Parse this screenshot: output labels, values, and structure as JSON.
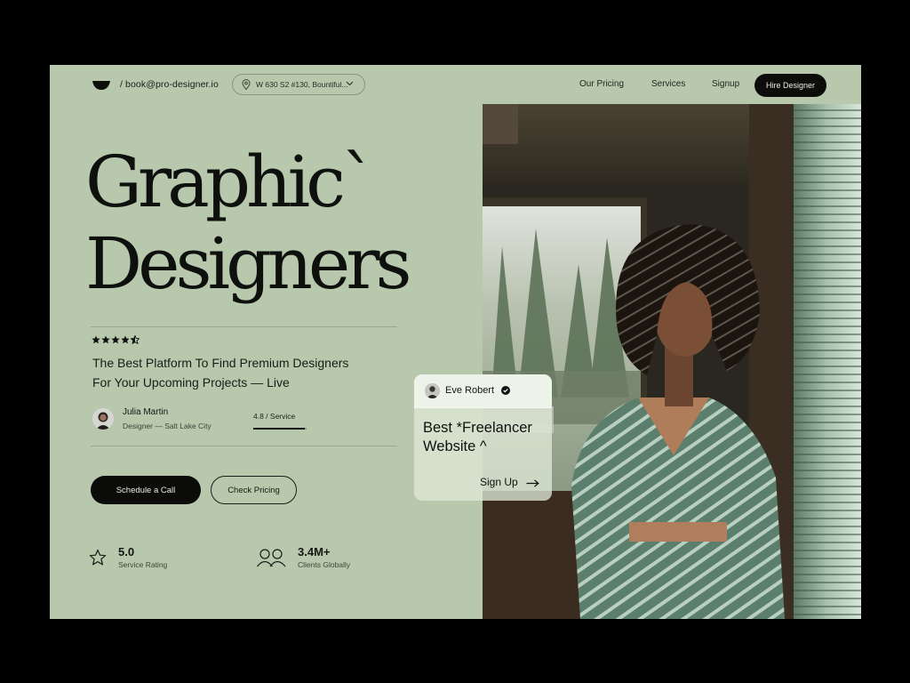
{
  "header": {
    "email": "/ book@pro-designer.io",
    "address": "W 630 S2 #130, Bountiful...",
    "nav": [
      "Our Pricing",
      "Services",
      "Signup"
    ],
    "cta": "Hire Designer"
  },
  "hero": {
    "title_line1": "Graphic`",
    "title_line2": "Designers",
    "rating_stars": 4.5,
    "tagline_line1": "The Best Platform To Find Premium Designers",
    "tagline_line2": "For Your Upcoming Projects — Live"
  },
  "author": {
    "name": "Julia Martin",
    "role": "Designer — Salt Lake City",
    "service": "4.8 / Service"
  },
  "actions": {
    "primary": "Schedule a Call",
    "secondary": "Check Pricing"
  },
  "stats": [
    {
      "value": "5.0",
      "label": "Service Rating",
      "icon": "star-icon"
    },
    {
      "value": "3.4M+",
      "label": "Clients Globally",
      "icon": "users-icon"
    }
  ],
  "card": {
    "name": "Eve Robert",
    "title_line1": "Best *Freelancer",
    "title_line2": "Website ^",
    "link": "Sign Up"
  },
  "colors": {
    "page_bg": "#b7c8ad",
    "dark": "#0c0d0b",
    "frame": "#000000"
  }
}
